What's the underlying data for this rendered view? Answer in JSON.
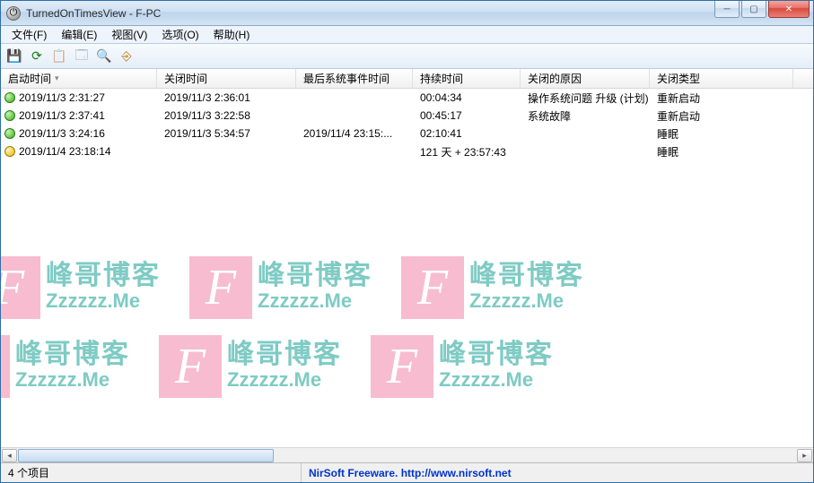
{
  "title": "TurnedOnTimesView  -  F-PC",
  "menus": [
    "文件(F)",
    "编辑(E)",
    "视图(V)",
    "选项(O)",
    "帮助(H)"
  ],
  "columns": [
    "启动时间",
    "关闭时间",
    "最后系统事件时间",
    "持续时间",
    "关闭的原因",
    "关闭类型"
  ],
  "sort_column_index": 0,
  "rows": [
    {
      "bullet": "green",
      "start": "2019/11/3 2:31:27",
      "shut": "2019/11/3 2:36:01",
      "last": "",
      "dur": "00:04:34",
      "reason": "操作系统问题 升级 (计划)",
      "type": "重新启动"
    },
    {
      "bullet": "green",
      "start": "2019/11/3 2:37:41",
      "shut": "2019/11/3 3:22:58",
      "last": "",
      "dur": "00:45:17",
      "reason": "系统故障",
      "type": "重新启动"
    },
    {
      "bullet": "green",
      "start": "2019/11/3 3:24:16",
      "shut": "2019/11/3 5:34:57",
      "last": "2019/11/4 23:15:...",
      "dur": "02:10:41",
      "reason": "",
      "type": "睡眠"
    },
    {
      "bullet": "yellow",
      "start": "2019/11/4 23:18:14",
      "shut": "",
      "last": "",
      "dur": "121 天 + 23:57:43",
      "reason": "",
      "type": "睡眠"
    }
  ],
  "status_left": "4 个项目",
  "status_right": "NirSoft Freeware.  http://www.nirsoft.net",
  "watermark": {
    "cn": "峰哥博客",
    "en": "Zzzzzz.Me"
  }
}
